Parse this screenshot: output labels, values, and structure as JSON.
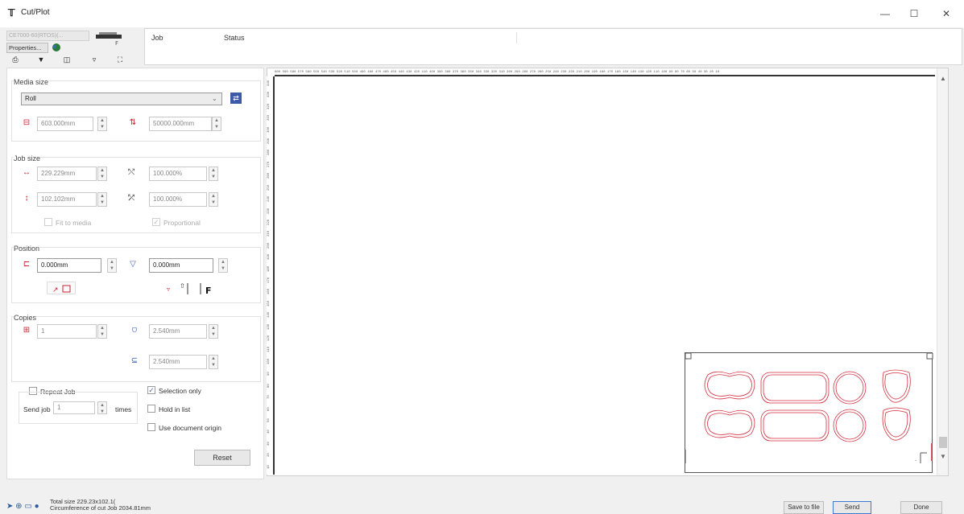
{
  "window": {
    "title": "Cut/Plot",
    "minimize": "—",
    "maximize": "☐",
    "close": "✕"
  },
  "device": {
    "name": "CE7000-60(RTOS)(...",
    "properties_label": "Properties..."
  },
  "joblist": {
    "columns": [
      "Job",
      "Status"
    ]
  },
  "media_size": {
    "label": "Media size",
    "type": "Roll",
    "width": "603.000mm",
    "length": "50000.000mm"
  },
  "job_size": {
    "label": "Job size",
    "width": "229.229mm",
    "height": "102.102mm",
    "scale_x": "100.000%",
    "scale_y": "100.000%",
    "fit_to_media": "Fit to media",
    "proportional": "Proportional"
  },
  "position": {
    "label": "Position",
    "x": "0.000mm",
    "y": "0.000mm"
  },
  "copies": {
    "label": "Copies",
    "count": "1",
    "spacing_x": "2.540mm",
    "spacing_y": "2.540mm"
  },
  "options": {
    "repeat_job": "Repeat Job",
    "send_job": "Send job",
    "send_job_value": "1",
    "times": "times",
    "selection_only": "Selection only",
    "hold_in_list": "Hold in list",
    "use_document_origin": "Use document origin",
    "reset": "Reset"
  },
  "ruler": {
    "top": "600 590 580 570 560 550 540 530 520 510 500 490 480 470 460 450 440 430 420 410 400 390 380 370 360 350 340 330 320 310 300 290 280 270 260 250 240 230 220 210 200 190 180 170 160 150 140 130 120 110 100 90 80 70 60 50 40 30 20 10",
    "left": [
      "340",
      "330",
      "320",
      "310",
      "300",
      "290",
      "280",
      "270",
      "260",
      "250",
      "240",
      "230",
      "220",
      "210",
      "200",
      "190",
      "180",
      "170",
      "160",
      "150",
      "140",
      "130",
      "120",
      "110",
      "100",
      "90",
      "80",
      "70",
      "60",
      "50",
      "40",
      "30",
      "20",
      "10"
    ]
  },
  "status": {
    "total_size": "Total size 229.23x102.1(",
    "circumference": "Circumference of cut Job 2034.81mm"
  },
  "footer": {
    "save_to_file": "Save to file",
    "send": "Send",
    "done": "Done"
  },
  "colors": {
    "cut_line": "#d32f3f",
    "accent": "#2a5b9c"
  }
}
